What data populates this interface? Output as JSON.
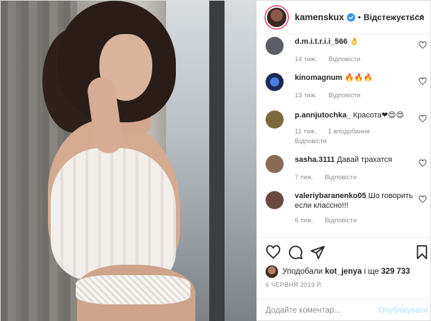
{
  "header": {
    "username": "kamenskux",
    "dot": "•",
    "follow_label": "Відстежується",
    "more": "···"
  },
  "comments": [
    {
      "username": "d.m.i.t.r.i.i_566",
      "text": "👌",
      "time": "14 тиж.",
      "reply": "Відповісти",
      "likes": "",
      "avatar_color": "#5a5f66"
    },
    {
      "username": "kinomagnum",
      "text": "🔥🔥🔥",
      "time": "13 тиж.",
      "reply": "Відповісти",
      "likes": "",
      "avatar_color": "#2a4f8a"
    },
    {
      "username": "p.annjutochka_",
      "text": "Красота❤😍😍",
      "time": "11 тиж.",
      "reply": "Відповісти",
      "likes": "1 вподобання",
      "avatar_color": "#7a6b3e"
    },
    {
      "username": "sasha.3111",
      "text": "Давай трахатся",
      "time": "7 тиж.",
      "reply": "Відповісти",
      "likes": "",
      "avatar_color": "#8a6a55"
    },
    {
      "username": "valeriybaranenko05",
      "text": "Шо говорить если классно!!!",
      "time": "6 тиж.",
      "reply": "Відповісти",
      "likes": "",
      "avatar_color": "#6a4a42"
    }
  ],
  "likes": {
    "prefix": "Уподобали",
    "user": "kot_jenya",
    "suffix": "і ще",
    "count": "329 733"
  },
  "date": "6 ЧЕРВНЯ 2019 Р.",
  "comment_input": {
    "placeholder": "Додайте коментар..."
  },
  "publish_label": "Опублікувати",
  "colors": {
    "accent": "#0095f6",
    "publish_disabled": "#b2dffc",
    "muted": "#8e8e8e",
    "text": "#262626"
  }
}
